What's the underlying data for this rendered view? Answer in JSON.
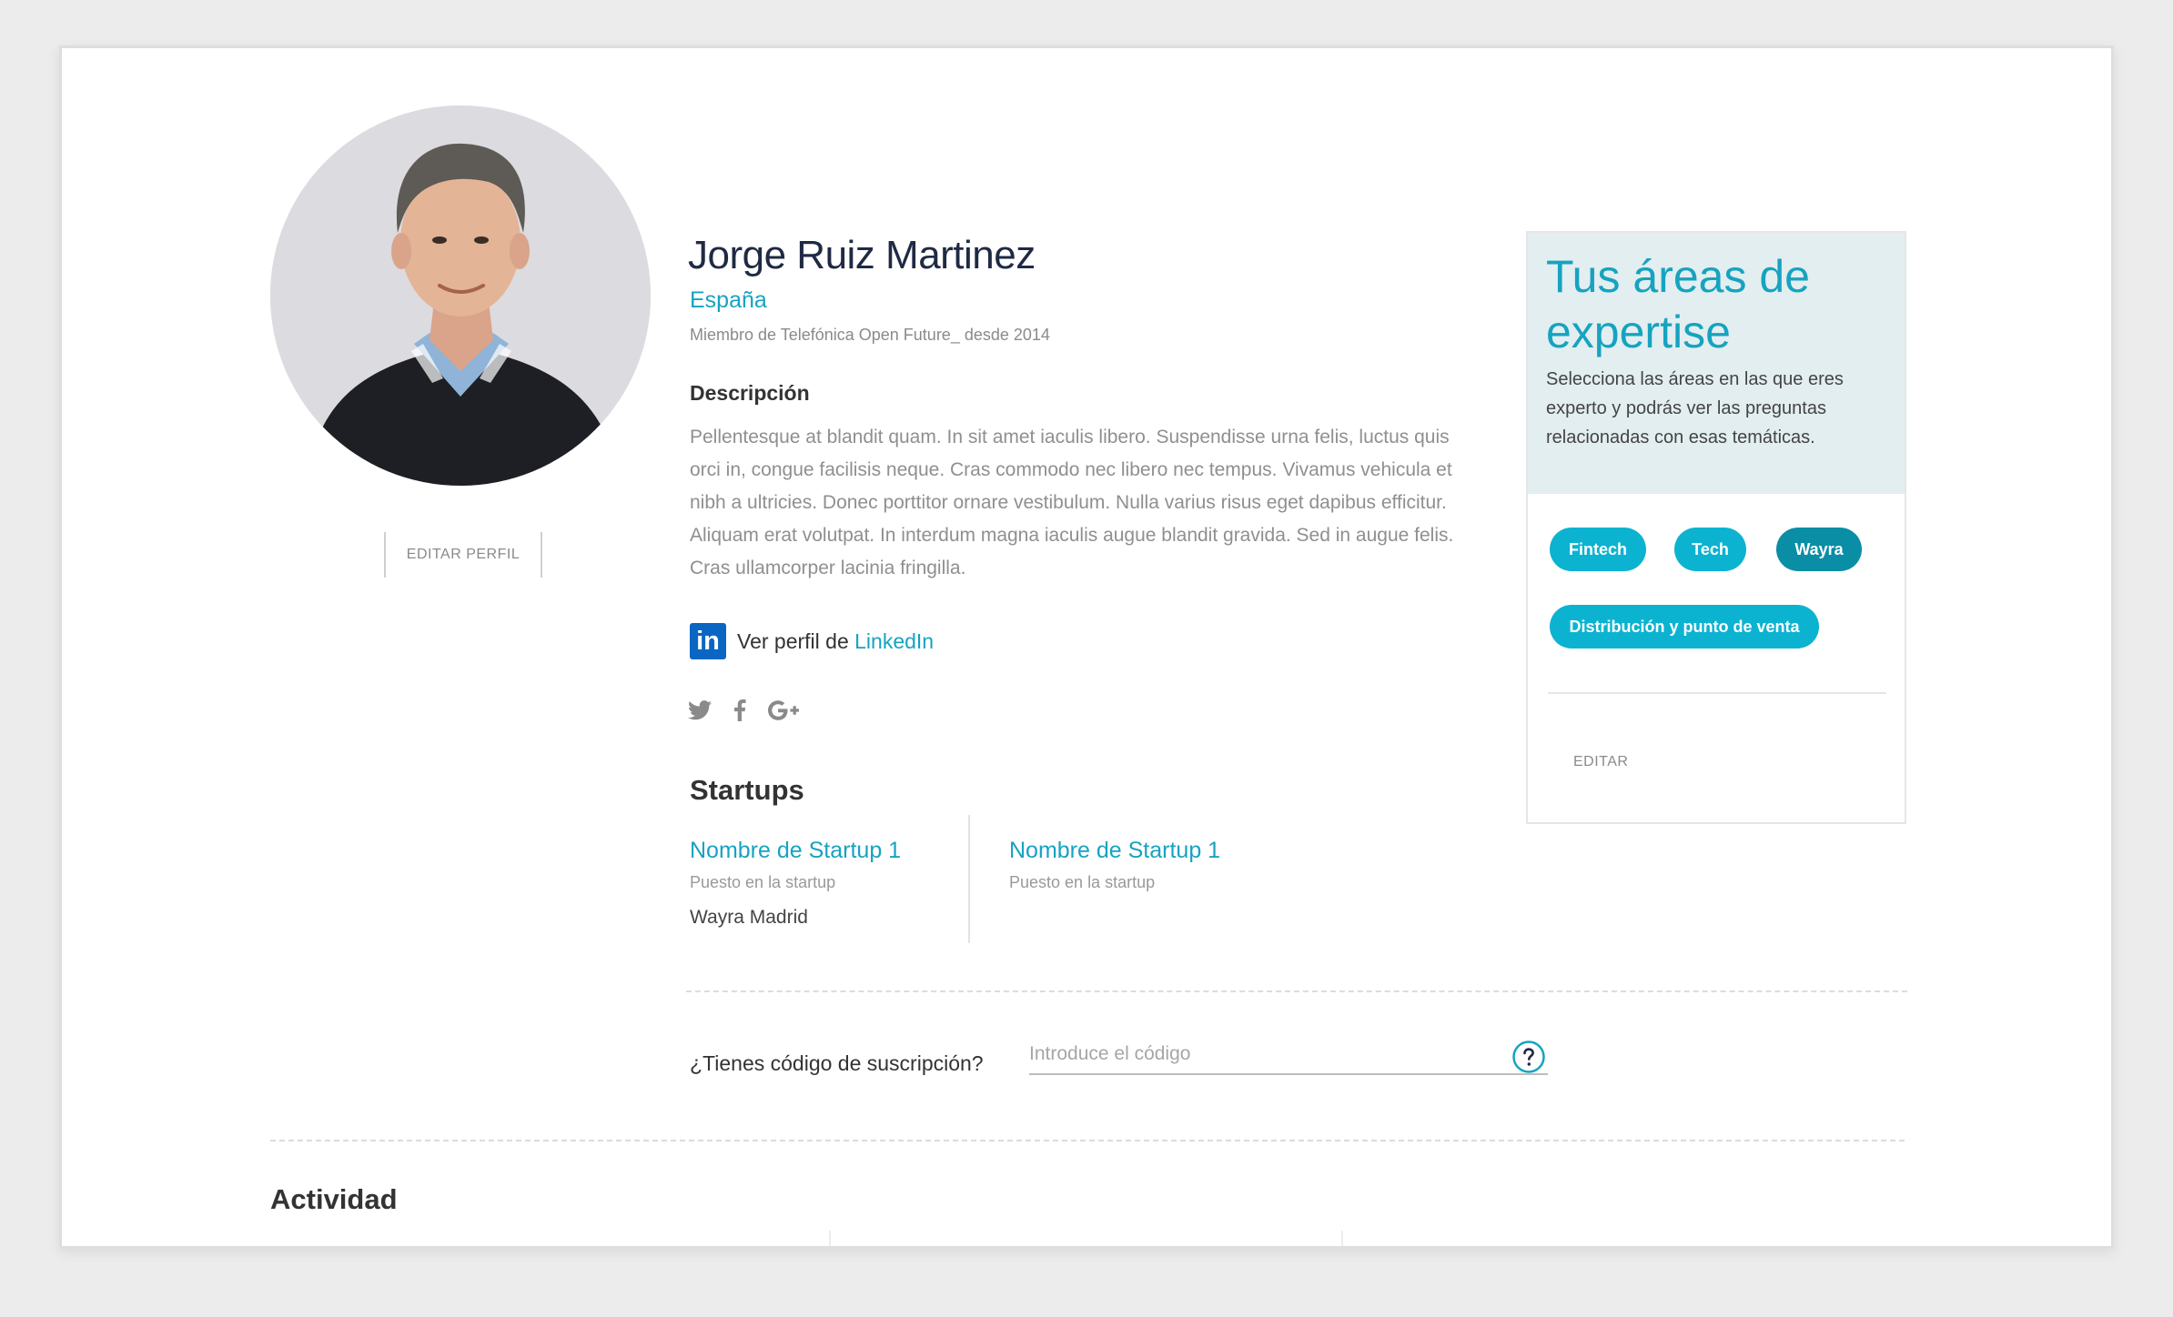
{
  "profile": {
    "name": "Jorge Ruiz Martinez",
    "country": "España",
    "member_since": "Miembro de Telefónica Open Future_ desde 2014",
    "edit_label": "EDITAR PERFIL",
    "description_title": "Descripción",
    "description": "Pellentesque at blandit quam. In sit amet iaculis libero. Suspendisse urna felis, luctus quis orci in, congue facilisis neque. Cras commodo nec libero nec tempus. Vivamus vehicula et nibh a ultricies. Donec porttitor ornare vestibulum. Nulla varius risus eget dapibus efficitur. Aliquam erat volutpat. In interdum magna iaculis augue blandit gravida. Sed in augue felis. Cras ullamcorper lacinia fringilla.",
    "linkedin_badge": "in",
    "linkedin_prefix": "Ver perfil de ",
    "linkedin_link": "LinkedIn",
    "socials": [
      {
        "icon": "twitter-icon"
      },
      {
        "icon": "facebook-icon"
      },
      {
        "icon": "google-plus-icon"
      }
    ]
  },
  "startups": {
    "title": "Startups",
    "items": [
      {
        "name": "Nombre de Startup 1",
        "role": "Puesto en la startup",
        "place": "Wayra Madrid"
      },
      {
        "name": "Nombre de Startup 1",
        "role": "Puesto en la startup"
      }
    ]
  },
  "subscription": {
    "label": "¿Tienes código de suscripción?",
    "placeholder": "Introduce el código",
    "value": ""
  },
  "activity": {
    "title": "Actividad"
  },
  "expertise": {
    "title": "Tus áreas de expertise",
    "description": "Selecciona las áreas en las que eres experto y podrás ver las preguntas relacionadas con esas temáticas.",
    "chips": [
      {
        "label": "Fintech"
      },
      {
        "label": "Tech"
      },
      {
        "label": "Wayra"
      },
      {
        "label": "Distribución y punto de venta"
      }
    ],
    "edit_label": "EDITAR"
  },
  "colors": {
    "accent": "#16a3c0",
    "chip": "#0bb3d1",
    "chip_dark": "#0a8ea6",
    "linkedin": "#0a66c2",
    "card_header": "#e3eef0"
  }
}
